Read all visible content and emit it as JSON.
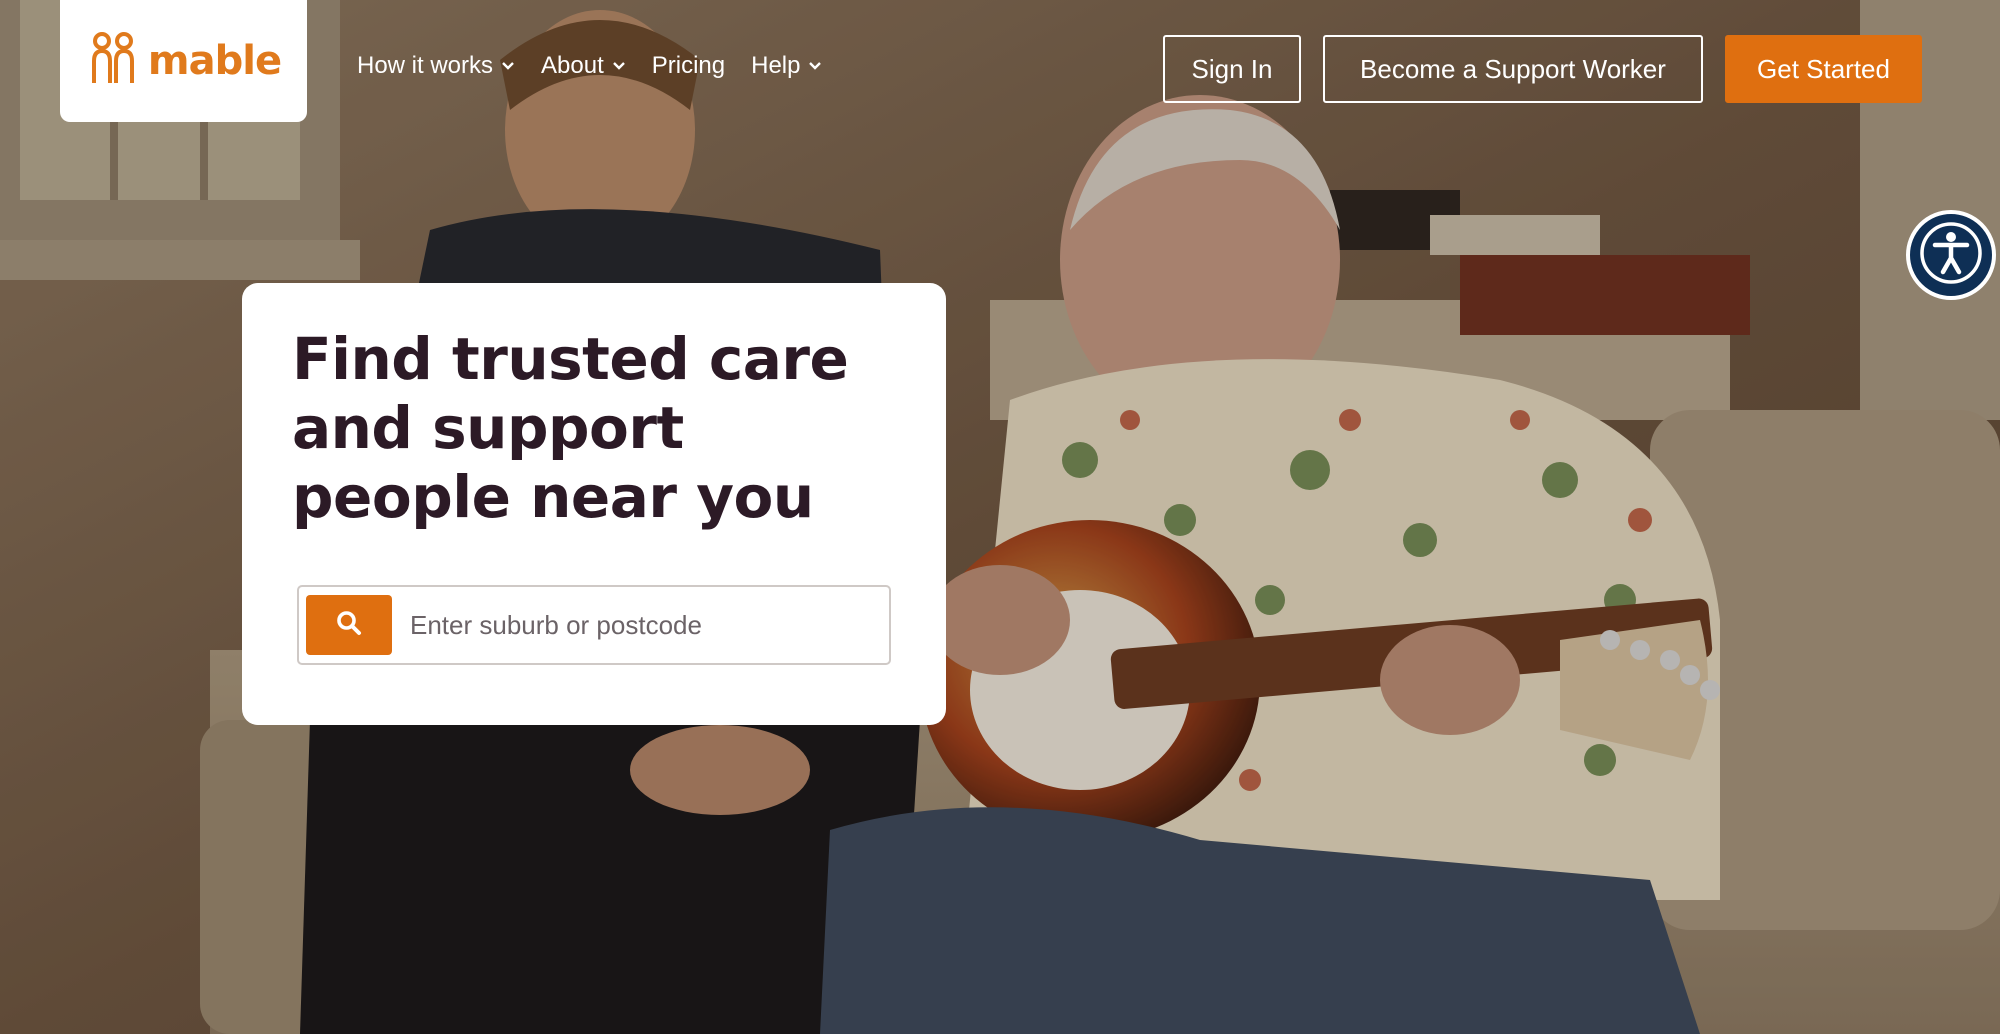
{
  "brand": {
    "name": "mable",
    "accent": "#df6f10",
    "text_dark": "#2c1a26"
  },
  "nav": {
    "items": [
      {
        "label": "How it works",
        "has_dropdown": true
      },
      {
        "label": "About",
        "has_dropdown": true
      },
      {
        "label": "Pricing",
        "has_dropdown": false
      },
      {
        "label": "Help",
        "has_dropdown": true
      }
    ]
  },
  "header_buttons": {
    "sign_in": "Sign In",
    "become_support_worker": "Become a Support Worker",
    "get_started": "Get Started"
  },
  "hero": {
    "headline": "Find trusted care and support people near you",
    "search": {
      "placeholder": "Enter suburb or postcode",
      "value": ""
    }
  },
  "icons": {
    "logo": "mable-logo-icon",
    "chevron": "chevron-down-icon",
    "search": "search-icon",
    "accessibility": "accessibility-icon"
  }
}
